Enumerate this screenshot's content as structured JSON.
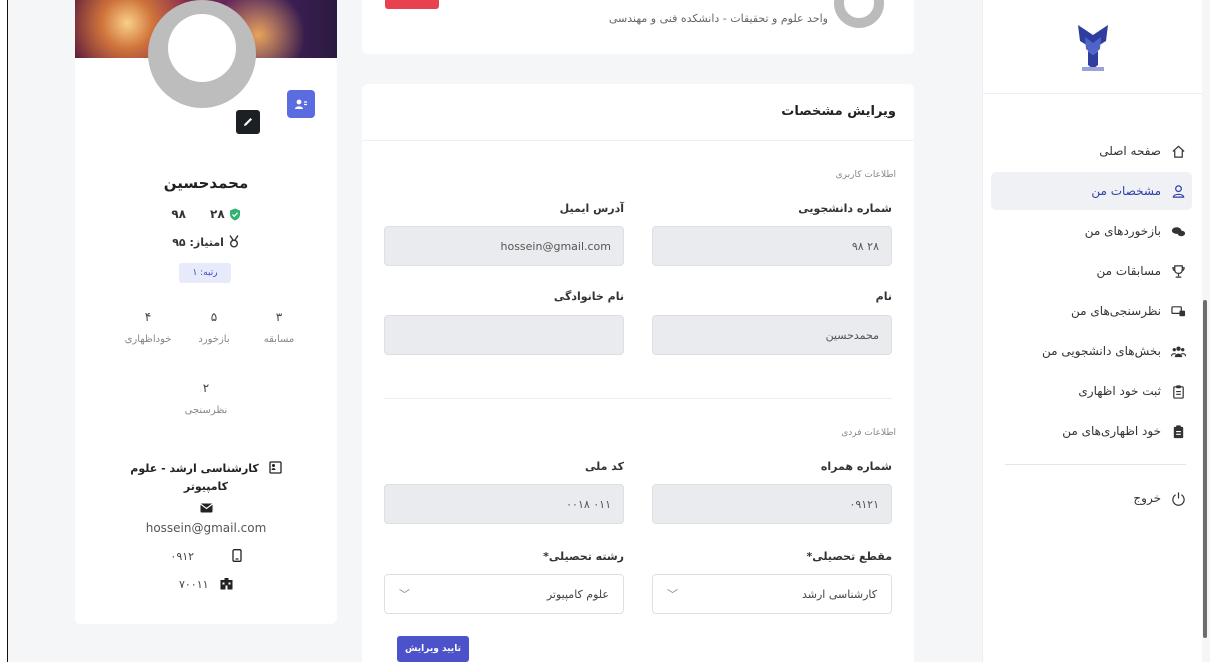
{
  "sidebar": {
    "items": [
      {
        "label": "صفحه اصلی",
        "icon": "home-icon"
      },
      {
        "label": "مشخصات من",
        "icon": "user-icon",
        "active": true
      },
      {
        "label": "بازخوردهای من",
        "icon": "comments-icon"
      },
      {
        "label": "مسابقات من",
        "icon": "trophy-icon"
      },
      {
        "label": "نظرسنجی‌های من",
        "icon": "survey-icon"
      },
      {
        "label": "بخش‌های دانشجویی من",
        "icon": "group-icon"
      },
      {
        "label": "ثبت خود اظهاری",
        "icon": "clipboard-icon"
      },
      {
        "label": "خود اظهاری‌های من",
        "icon": "clipboard-list-icon"
      }
    ],
    "logout": "خروج"
  },
  "top": {
    "unit": "واحد علوم و تحقیقات - دانشکده فنی و مهندسی"
  },
  "form": {
    "title": "ویرایش مشخصات",
    "section_user": "اطلاعات کاربری",
    "section_personal": "اطلاعات فردی",
    "student_id_label": "شماره دانشجویی",
    "student_id_value": "۹۸  ۲۸",
    "email_label": "آدرس ایمیل",
    "email_value": "hossein@gmail.com",
    "first_name_label": "نام",
    "first_name_value": "محمدحسین",
    "last_name_label": "نام خانوادگی",
    "last_name_value": "",
    "mobile_label": "شماره همراه",
    "mobile_value": "۰۹۱۲۱",
    "national_code_label": "کد ملی",
    "national_code_value": "۰۰۱۸  ۰۱۱",
    "degree_label": "مقطع تحصیلی*",
    "degree_value": "کارشناسی ارشد",
    "major_label": "رشته تحصیلی*",
    "major_value": "علوم کامپیوتر",
    "submit": "تایید ویرایش"
  },
  "profile": {
    "name": "محمدحسین",
    "id_left": "۹۸",
    "id_right": "۲۸",
    "score": "امتیاز: ۹۵",
    "rank": "رتبه: ۱",
    "stats": [
      {
        "num": "۳",
        "label": "مسابقه"
      },
      {
        "num": "۵",
        "label": "بازخورد"
      },
      {
        "num": "۴",
        "label": "خوداظهاری"
      }
    ],
    "survey_num": "۲",
    "survey_label": "نظرسنجی",
    "degree": "کارشناسی ارشد - علوم کامپیوتر",
    "email": "hossein@gmail.com",
    "phone": "۰۹۱۲",
    "code": "۷۰۰۱۱"
  }
}
